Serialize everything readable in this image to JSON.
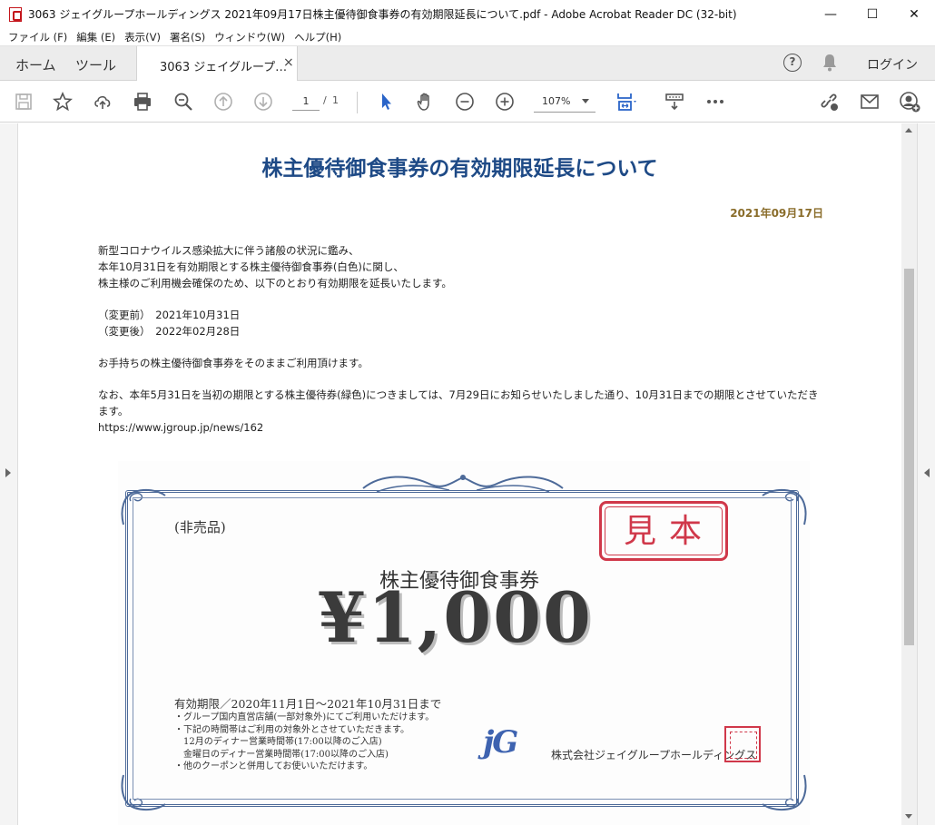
{
  "window": {
    "title": "3063 ジェイグループホールディングス 2021年09月17日株主優待御食事券の有効期限延長について.pdf - Adobe Acrobat Reader DC (32-bit)",
    "minimize": "—",
    "maximize": "☐",
    "close": "✕"
  },
  "menu": [
    "ファイル (F)",
    "編集 (E)",
    "表示(V)",
    "署名(S)",
    "ウィンドウ(W)",
    "ヘルプ(H)"
  ],
  "tabs": {
    "home": "ホーム",
    "tools": "ツール",
    "document": "3063 ジェイグループ…",
    "close": "×",
    "help": "?",
    "login": "ログイン"
  },
  "toolbar": {
    "page_current": "1",
    "page_separator": "/",
    "page_total": "1",
    "zoom": "107%",
    "icons": [
      "save-icon",
      "star-icon",
      "upload-icon",
      "print-icon",
      "zoom-search-icon",
      "page-up-icon",
      "page-down-icon",
      "select-pointer-icon",
      "hand-icon",
      "zoom-out-icon",
      "zoom-in-icon",
      "fit-page-icon",
      "scroll-mode-icon",
      "more-icon",
      "share-link-icon",
      "mail-icon",
      "add-user-icon"
    ]
  },
  "document": {
    "heading": "株主優待御食事券の有効期限延長について",
    "date": "2021年09月17日",
    "lines": {
      "l1": "新型コロナウイルス感染拡大に伴う諸般の状況に鑑み、",
      "l2": "本年10月31日を有効期限とする株主優待御食事券(白色)に関し、",
      "l3": "株主様のご利用機会確保のため、以下のとおり有効期限を延長いたします。",
      "before": "（変更前）　2021年10月31日",
      "after": "（変更後）　2022年02月28日",
      "l4": "お手持ちの株主優待御食事券をそのままご利用頂けます。",
      "l5": "なお、本年5月31日を当初の期限とする株主優待券(緑色)につきましては、7月29日にお知らせいたしました通り、10月31日までの期限とさせていただきます。",
      "url": "https://www.jgroup.jp/news/162"
    }
  },
  "voucher": {
    "nonsale": "(非売品)",
    "stamp": "見本",
    "name": "株主優待御食事券",
    "price": "¥1,000",
    "validity": "有効期限／2020年11月1日～2021年10月31日まで",
    "notes": [
      "・グループ国内直営店舗(一部対象外)にてご利用いただけます。",
      "・下記の時間帯はご利用の対象外とさせていただきます。",
      "　12月のディナー営業時間帯(17:00以降のご入店)",
      "　金曜日のディナー営業時間帯(17:00以降のご入店)",
      "・他のクーポンと併用してお使いいただけます。"
    ],
    "logo": "jG",
    "company": "株式会社ジェイグループホールディングス"
  },
  "colors": {
    "heading": "#1e4a86",
    "date": "#8a6d2b",
    "stamp": "#d0384a",
    "voucher_frame": "#4d6a99",
    "tab_active": "#ffffff",
    "tab_bar": "#ececec",
    "accent_blue": "#2a64c8"
  }
}
